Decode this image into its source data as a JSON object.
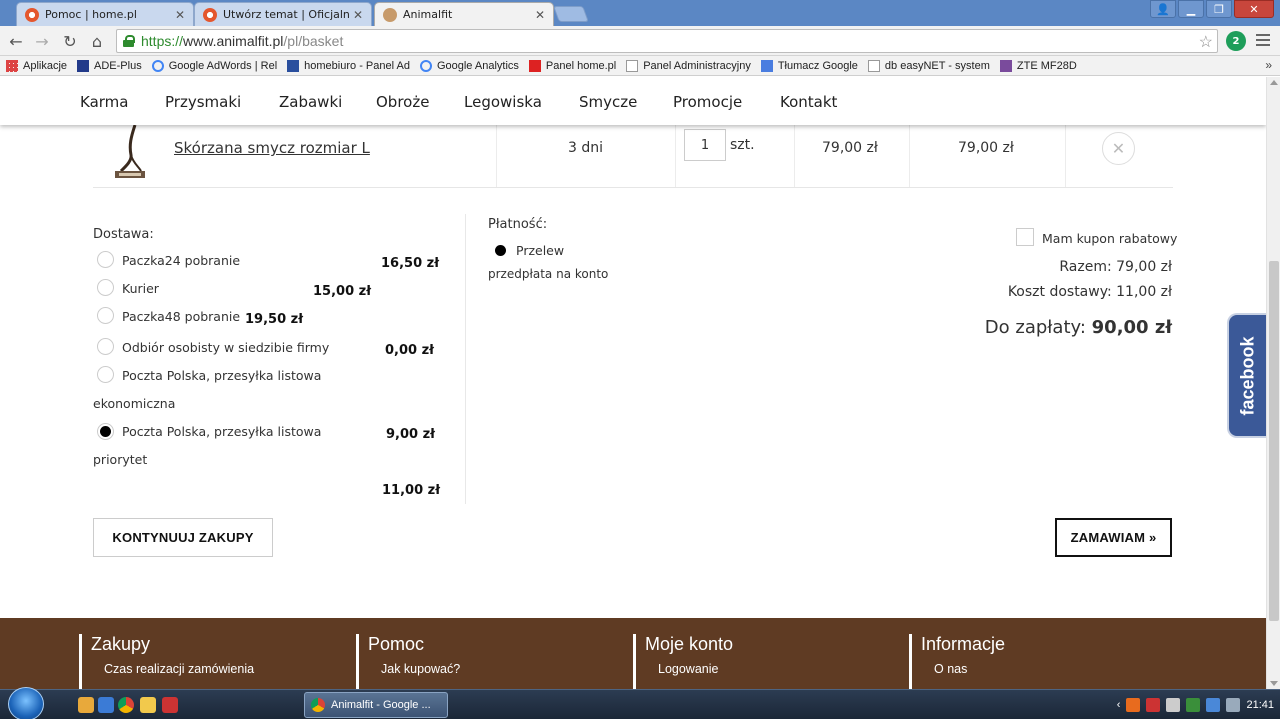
{
  "browser": {
    "tabs": [
      {
        "label": "Pomoc | home.pl",
        "favicon_color": "#e4572e"
      },
      {
        "label": "Utwórz temat | Oficjalne fo",
        "favicon_color": "#e4572e"
      },
      {
        "label": "Animalfit",
        "favicon_color": "#c79a6a"
      }
    ],
    "url_https": "https://",
    "url_host": "www.animalfit.pl",
    "url_path": "/pl/basket",
    "extension_badge": "2"
  },
  "bookmarks": [
    {
      "label": "Aplikacje",
      "icon_color": "#d44"
    },
    {
      "label": "ADE-Plus",
      "icon_color": "#223a8a"
    },
    {
      "label": "Google AdWords | Rel",
      "icon_color": "#4285f4"
    },
    {
      "label": "homebiuro - Panel Ad",
      "icon_color": "#2a4f9e"
    },
    {
      "label": "Google Analytics",
      "icon_color": "#4285f4"
    },
    {
      "label": "Panel home.pl",
      "icon_color": "#d22"
    },
    {
      "label": "Panel Administracyjny",
      "icon_color": "#999"
    },
    {
      "label": "Tłumacz Google",
      "icon_color": "#4a7de0"
    },
    {
      "label": "db easyNET - system",
      "icon_color": "#999"
    },
    {
      "label": "ZTE MF28D",
      "icon_color": "#7a4b9c"
    }
  ],
  "bookmarks_more": "»",
  "nav": [
    "Karma",
    "Przysmaki",
    "Zabawki",
    "Obroże",
    "Legowiska",
    "Smycze",
    "Promocje",
    "Kontakt"
  ],
  "product": {
    "name": "Skórzana smycz rozmiar L",
    "delivery_time": "3 dni",
    "quantity": "1",
    "unit": "szt.",
    "unit_price": "79,00 zł",
    "total": "79,00 zł"
  },
  "delivery": {
    "title": "Dostawa:",
    "options": [
      {
        "label": "Paczka24 pobranie",
        "price": "16,50 zł",
        "checked": false
      },
      {
        "label": "Kurier",
        "price": "15,00 zł",
        "checked": false
      },
      {
        "label": "Paczka48 pobranie",
        "price": "19,50 zł",
        "checked": false
      },
      {
        "label": "Odbiór osobisty w siedzibie firmy",
        "price": "0,00 zł",
        "checked": false
      },
      {
        "label": "Poczta Polska, przesyłka listowa",
        "label2": "ekonomiczna",
        "price": "",
        "checked": false
      },
      {
        "label": "Poczta Polska, przesyłka listowa",
        "label2": "priorytet",
        "price": "9,00 zł",
        "checked": true
      }
    ],
    "extra_price": "11,00 zł"
  },
  "payment": {
    "title": "Płatność:",
    "option": "Przelew",
    "description": "przedpłata na konto"
  },
  "summary": {
    "coupon_label": "Mam kupon rabatowy",
    "subtotal": "Razem: 79,00 zł",
    "shipping": "Koszt dostawy: 11,00 zł",
    "total_label": "Do zapłaty:",
    "total_value": "90,00 zł"
  },
  "buttons": {
    "continue": "KONTYNUUJ ZAKUPY",
    "order": "ZAMAWIAM »"
  },
  "facebook_label": "facebook",
  "footer": [
    {
      "title": "Zakupy",
      "link": "Czas realizacji zamówienia"
    },
    {
      "title": "Pomoc",
      "link": "Jak kupować?"
    },
    {
      "title": "Moje konto",
      "link": "Logowanie"
    },
    {
      "title": "Informacje",
      "link": "O nas"
    }
  ],
  "taskbar": {
    "app_label": "Animalfit - Google ...",
    "clock": "21:41"
  },
  "colors": {
    "footer_bg": "#5f3b23",
    "facebook": "#3b5998",
    "url_green": "#2e8b2e"
  }
}
